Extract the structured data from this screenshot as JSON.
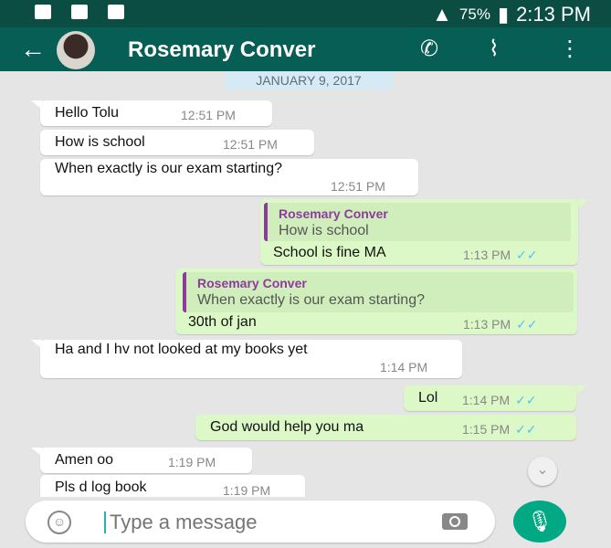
{
  "status_bar": {
    "battery": "75%",
    "time": "2:13 PM"
  },
  "header": {
    "contact_name": "Rosemary Conver"
  },
  "chat": {
    "date_chip": "JANUARY 9, 2017",
    "messages": [
      {
        "text": "Hello Tolu",
        "time": "12:51 PM"
      },
      {
        "text": "How is school",
        "time": "12:51 PM"
      },
      {
        "text": "When exactly is our exam starting?",
        "time": "12:51 PM"
      },
      {
        "quote_name": "Rosemary Conver",
        "quote_text": "How is school",
        "text": "School is fine MA",
        "time": "1:13 PM"
      },
      {
        "quote_name": "Rosemary Conver",
        "quote_text": "When exactly is our exam starting?",
        "text": "30th of jan",
        "time": "1:13 PM"
      },
      {
        "text": "Ha and I hv not looked at my books yet",
        "time": "1:14 PM"
      },
      {
        "text": "Lol",
        "time": "1:14 PM"
      },
      {
        "text": "God would help you ma",
        "time": "1:15 PM"
      },
      {
        "text": "Amen oo",
        "time": "1:19 PM"
      },
      {
        "text": "Pls d log book",
        "time": "1:19 PM"
      }
    ]
  },
  "composer": {
    "placeholder": "Type a message"
  }
}
